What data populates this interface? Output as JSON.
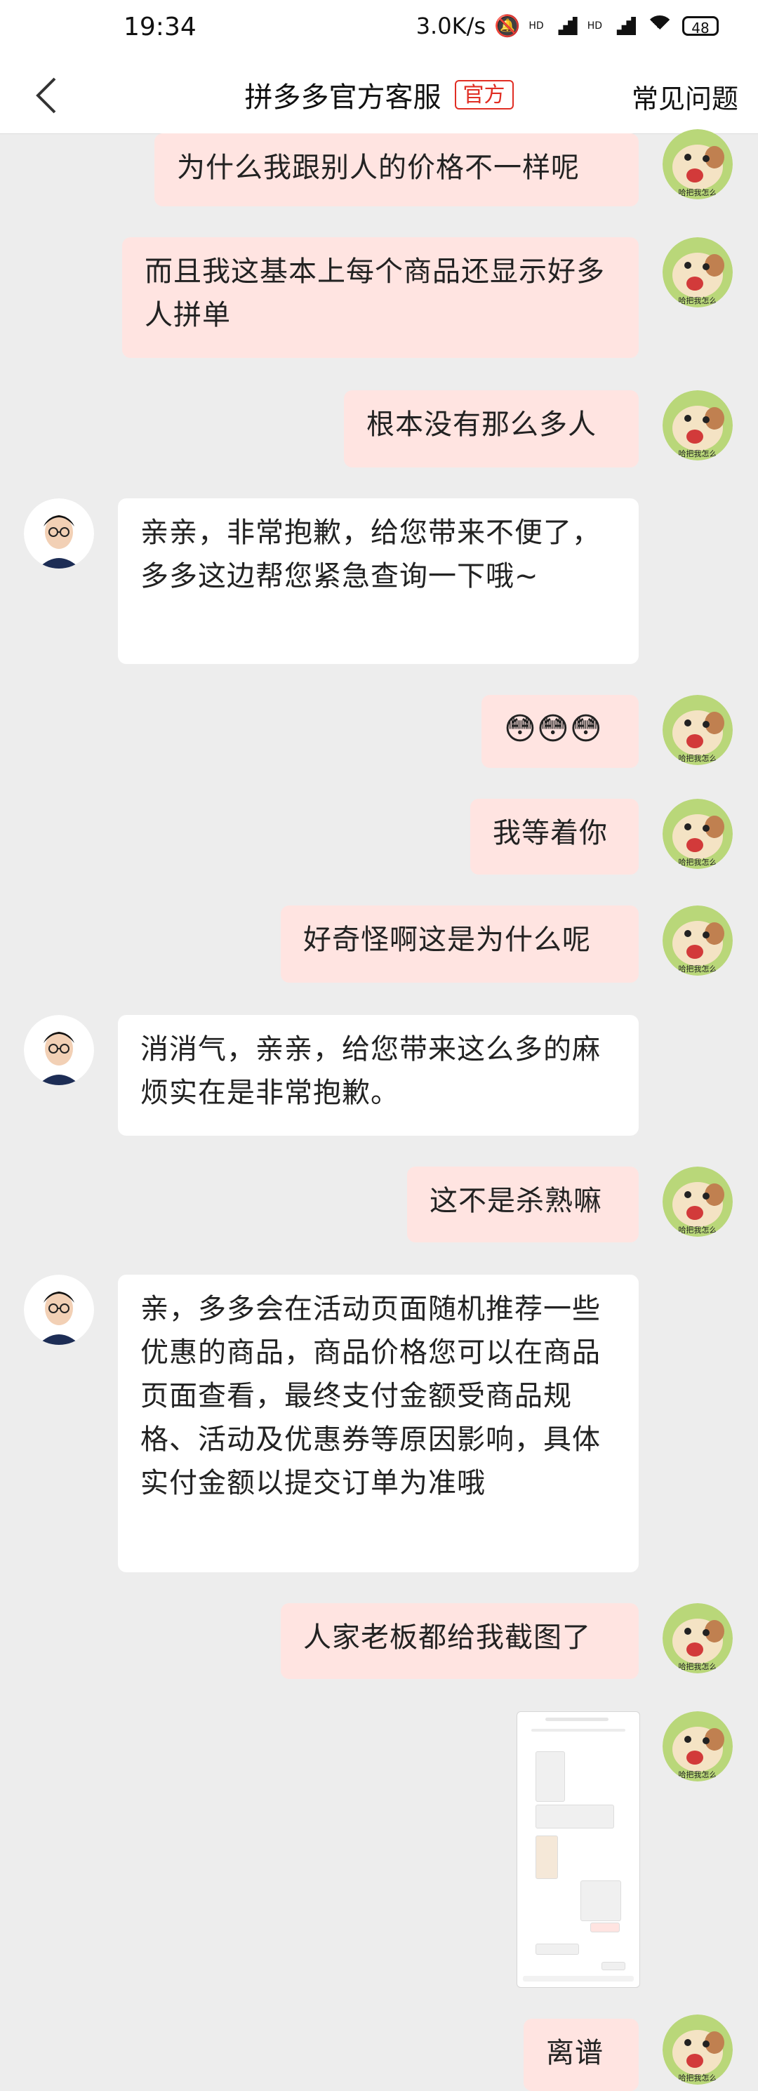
{
  "status_bar": {
    "time": "19:34",
    "speed": "3.0K/s",
    "hd1": "HD",
    "hd2": "HD",
    "battery": "48"
  },
  "header": {
    "title": "拼多多官方客服",
    "badge": "官方",
    "faq": "常见问题"
  },
  "messages": [
    {
      "side": "out",
      "text": "为什么我跟别人的价格不一样呢"
    },
    {
      "side": "out",
      "text": "而且我这基本上每个商品还显示好多人拼单"
    },
    {
      "side": "out",
      "text": "根本没有那么多人"
    },
    {
      "side": "in",
      "text": "亲亲，非常抱歉，给您带来不便了，多多这边帮您紧急查询一下哦~"
    },
    {
      "side": "out",
      "text": "😳😳😳"
    },
    {
      "side": "out",
      "text": "我等着你"
    },
    {
      "side": "out",
      "text": "好奇怪啊这是为什么呢"
    },
    {
      "side": "in",
      "text": "消消气，亲亲，给您带来这么多的麻烦实在是非常抱歉。"
    },
    {
      "side": "out",
      "text": "这不是杀熟嘛"
    },
    {
      "side": "in",
      "text": "亲，多多会在活动页面随机推荐一些优惠的商品，商品价格您可以在商品页面查看，最终支付金额受商品规格、活动及优惠券等原因影响，具体实付金额以提交订单为准哦"
    },
    {
      "side": "out",
      "text": "人家老板都给我截图了"
    },
    {
      "side": "out",
      "text": "离谱"
    }
  ],
  "colors": {
    "outgoing_bubble": "#ffe4e1",
    "incoming_bubble": "#ffffff",
    "background": "#ededed",
    "accent": "#e02e24"
  }
}
